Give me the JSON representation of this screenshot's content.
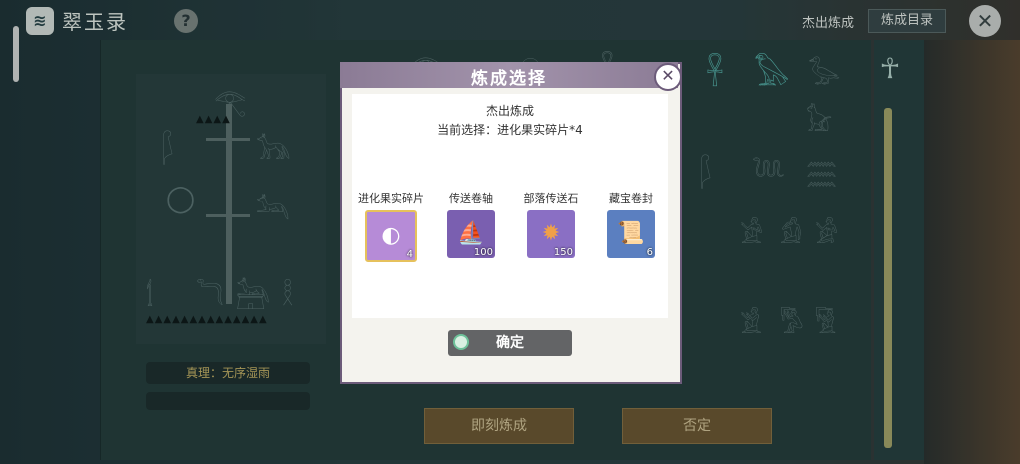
{
  "app": {
    "title": "翠玉录",
    "help": "?"
  },
  "top_nav": {
    "tab_plain": "杰出炼成",
    "tab_box": "炼成目录",
    "close_symbol": "✕"
  },
  "background": {
    "truth_label": "真理：无序湿雨",
    "button_left": "即刻炼成",
    "button_right": "否定"
  },
  "dialog": {
    "title": "炼成选择",
    "subtitle": "杰出炼成",
    "current_selection": "当前选择：进化果实碎片*4",
    "items": [
      {
        "label": "进化果实碎片",
        "count": "4",
        "icon": "fruit-slice-icon",
        "color": "#b68bd7"
      },
      {
        "label": "传送卷轴",
        "count": "100",
        "icon": "scroll-ship-icon",
        "color": "#7a5fb0"
      },
      {
        "label": "部落传送石",
        "count": "150",
        "icon": "fire-stone-icon",
        "color": "#8a6fc4"
      },
      {
        "label": "藏宝卷封",
        "count": "6",
        "icon": "treasure-scroll-icon",
        "color": "#5b7fc0"
      }
    ],
    "confirm": "确定",
    "close_symbol": "✕"
  }
}
